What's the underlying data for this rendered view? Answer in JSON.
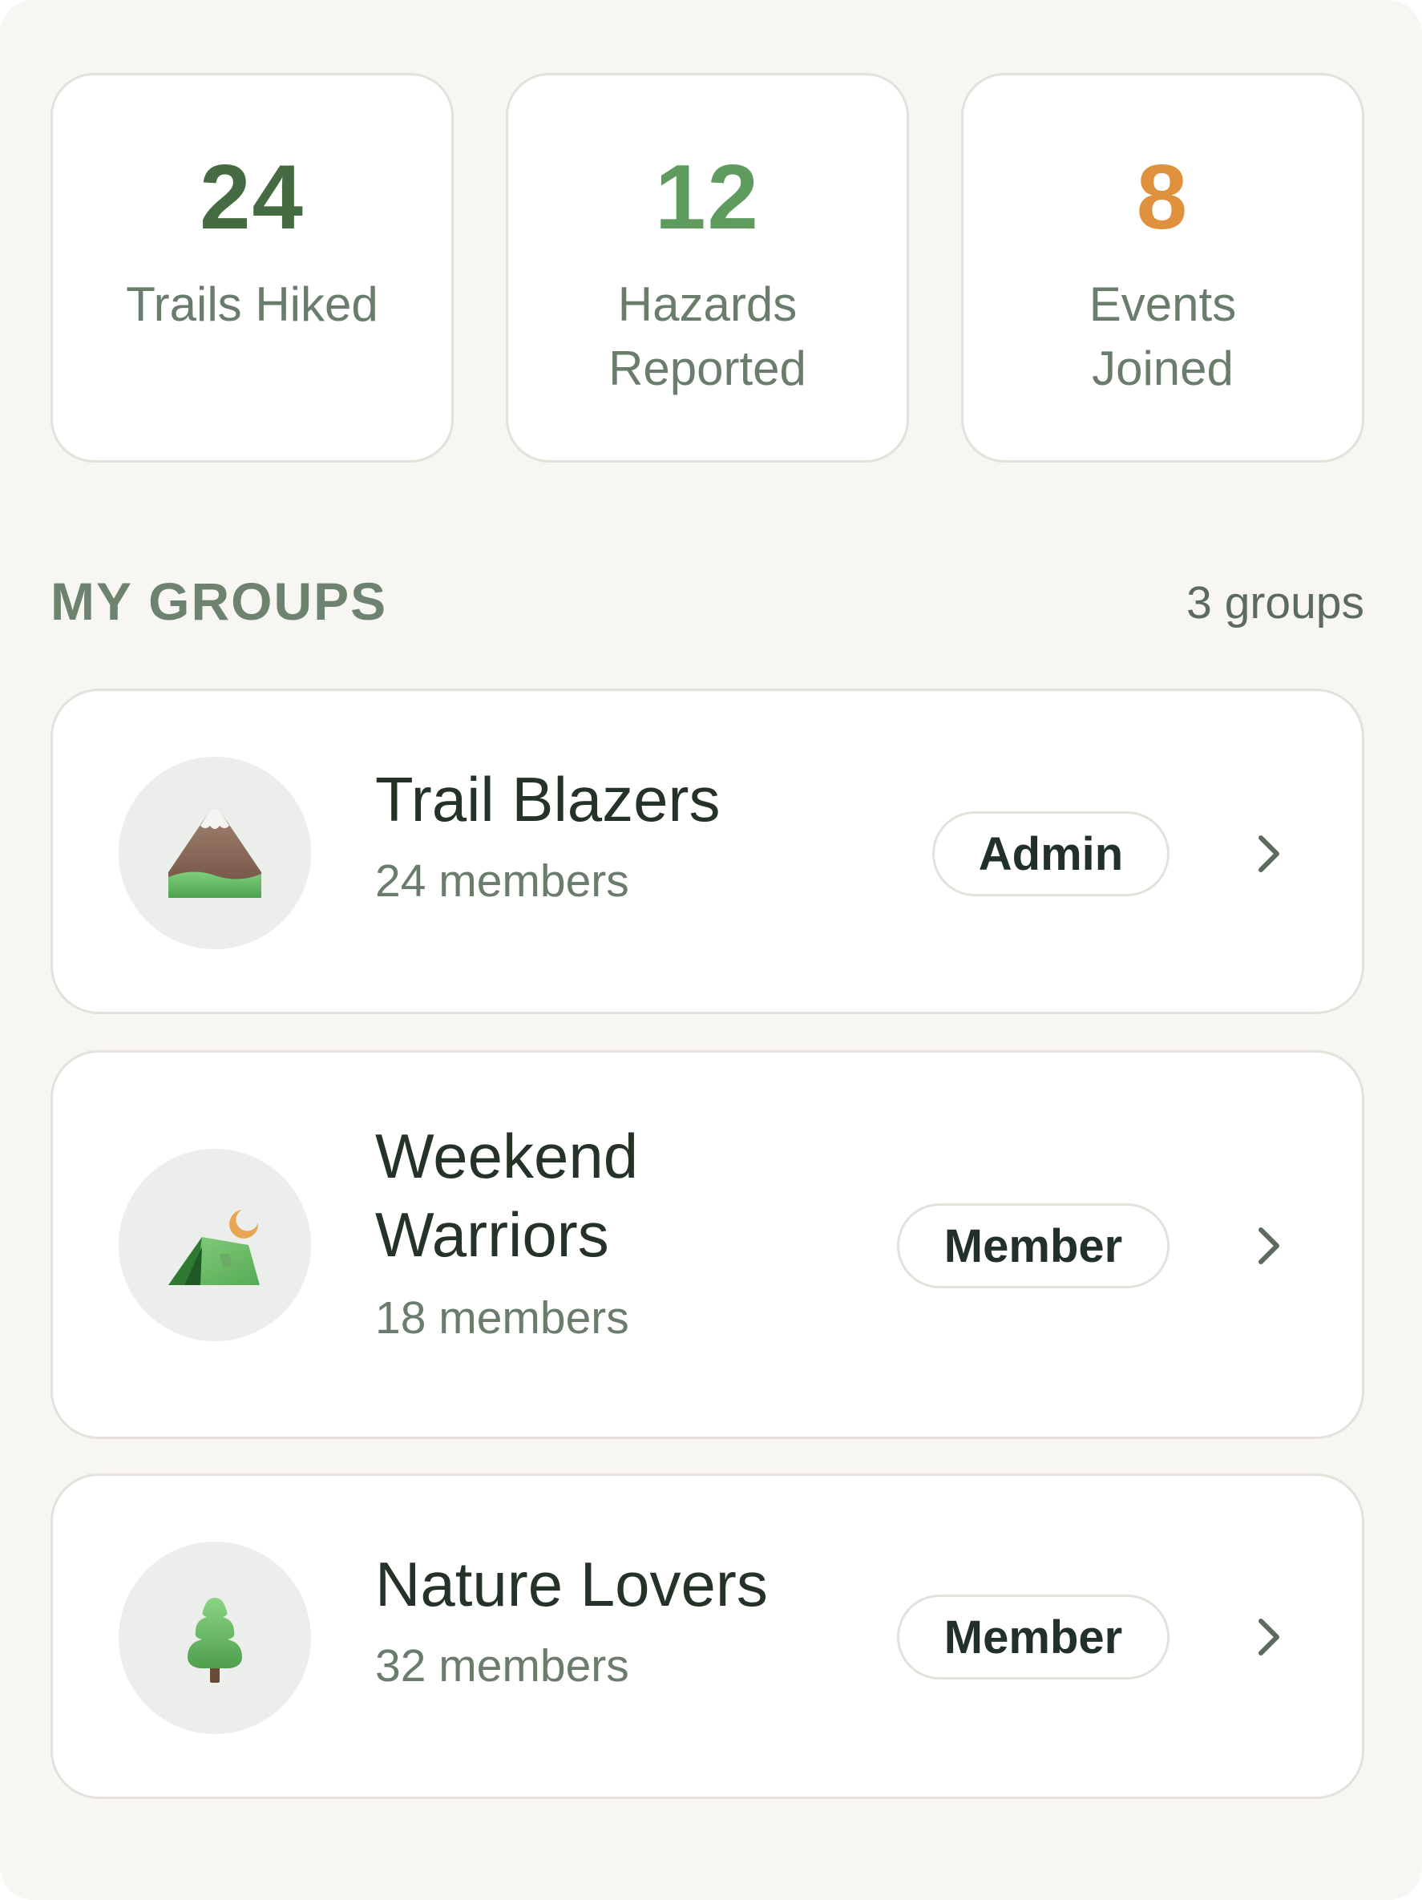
{
  "stats": [
    {
      "value": "24",
      "label": "Trails Hiked",
      "color": "#456b42"
    },
    {
      "value": "12",
      "label": "Hazards Reported",
      "color": "#5f9b5d"
    },
    {
      "value": "8",
      "label": "Events Joined",
      "color": "#e0913d"
    }
  ],
  "groups_section": {
    "title": "MY GROUPS",
    "count": "3 groups"
  },
  "groups": [
    {
      "name": "Trail Blazers",
      "members": "24 members",
      "role": "Admin",
      "icon": "mountain-icon"
    },
    {
      "name": "Weekend Warriors",
      "members": "18 members",
      "role": "Member",
      "icon": "tent-icon"
    },
    {
      "name": "Nature Lovers",
      "members": "32 members",
      "role": "Member",
      "icon": "tree-icon"
    }
  ],
  "colors": {
    "background": "#f7f6f2",
    "card": "#ffffff",
    "border": "#e3e1da",
    "muted_green": "#6a7c6c",
    "dark_text": "#243227"
  }
}
